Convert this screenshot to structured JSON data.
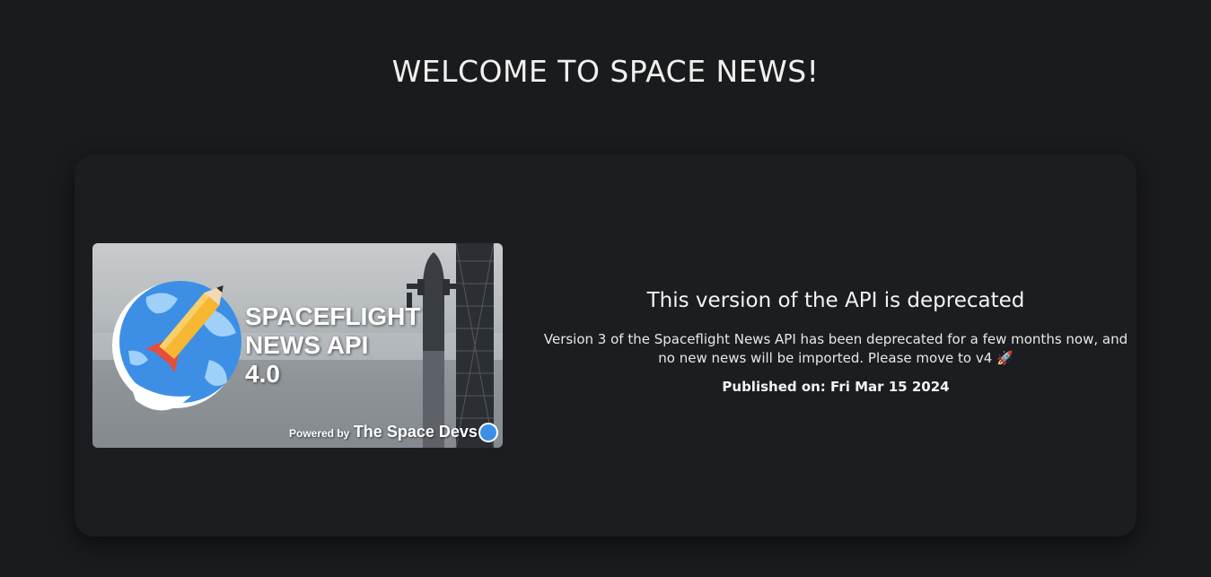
{
  "page": {
    "title": "WELCOME TO SPACE NEWS!"
  },
  "article": {
    "image": {
      "title_lines": [
        "SPACEFLIGHT",
        "NEWS API",
        "4.0"
      ],
      "powered_by": "Powered by",
      "powered_by_name": "The Space Devs"
    },
    "headline": "This version of the API is deprecated",
    "summary": "Version 3 of the Spaceflight News API has been deprecated for a few months now, and no new news will be imported. Please move to v4 🚀",
    "published": "Published on: Fri Mar 15 2024"
  },
  "colors": {
    "background": "#1a1b1d",
    "card": "#1c1d20",
    "globe": "#3d8fe6"
  }
}
